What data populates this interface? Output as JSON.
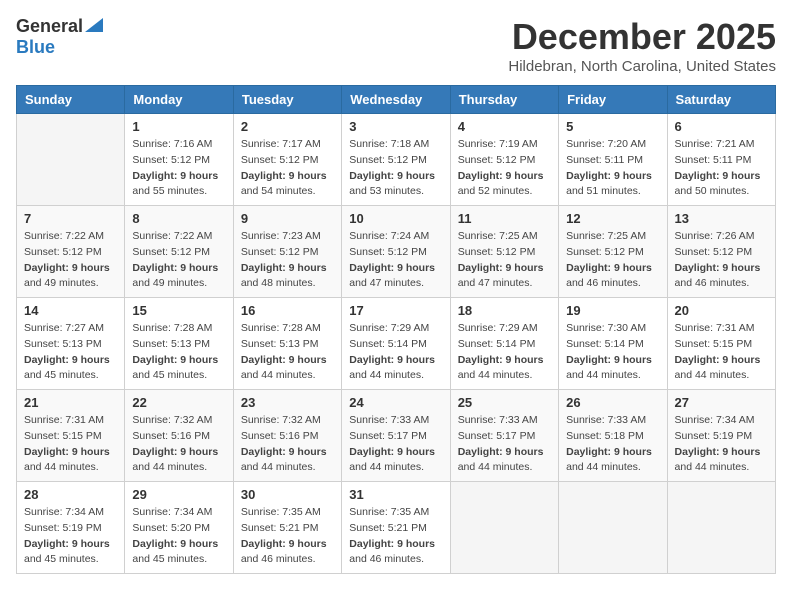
{
  "logo": {
    "general": "General",
    "blue": "Blue"
  },
  "title": "December 2025",
  "location": "Hildebran, North Carolina, United States",
  "days_of_week": [
    "Sunday",
    "Monday",
    "Tuesday",
    "Wednesday",
    "Thursday",
    "Friday",
    "Saturday"
  ],
  "weeks": [
    [
      {
        "day": "",
        "info": ""
      },
      {
        "day": "1",
        "info": "Sunrise: 7:16 AM\nSunset: 5:12 PM\nDaylight: 9 hours\nand 55 minutes."
      },
      {
        "day": "2",
        "info": "Sunrise: 7:17 AM\nSunset: 5:12 PM\nDaylight: 9 hours\nand 54 minutes."
      },
      {
        "day": "3",
        "info": "Sunrise: 7:18 AM\nSunset: 5:12 PM\nDaylight: 9 hours\nand 53 minutes."
      },
      {
        "day": "4",
        "info": "Sunrise: 7:19 AM\nSunset: 5:12 PM\nDaylight: 9 hours\nand 52 minutes."
      },
      {
        "day": "5",
        "info": "Sunrise: 7:20 AM\nSunset: 5:11 PM\nDaylight: 9 hours\nand 51 minutes."
      },
      {
        "day": "6",
        "info": "Sunrise: 7:21 AM\nSunset: 5:11 PM\nDaylight: 9 hours\nand 50 minutes."
      }
    ],
    [
      {
        "day": "7",
        "info": "Sunrise: 7:22 AM\nSunset: 5:12 PM\nDaylight: 9 hours\nand 49 minutes."
      },
      {
        "day": "8",
        "info": "Sunrise: 7:22 AM\nSunset: 5:12 PM\nDaylight: 9 hours\nand 49 minutes."
      },
      {
        "day": "9",
        "info": "Sunrise: 7:23 AM\nSunset: 5:12 PM\nDaylight: 9 hours\nand 48 minutes."
      },
      {
        "day": "10",
        "info": "Sunrise: 7:24 AM\nSunset: 5:12 PM\nDaylight: 9 hours\nand 47 minutes."
      },
      {
        "day": "11",
        "info": "Sunrise: 7:25 AM\nSunset: 5:12 PM\nDaylight: 9 hours\nand 47 minutes."
      },
      {
        "day": "12",
        "info": "Sunrise: 7:25 AM\nSunset: 5:12 PM\nDaylight: 9 hours\nand 46 minutes."
      },
      {
        "day": "13",
        "info": "Sunrise: 7:26 AM\nSunset: 5:12 PM\nDaylight: 9 hours\nand 46 minutes."
      }
    ],
    [
      {
        "day": "14",
        "info": "Sunrise: 7:27 AM\nSunset: 5:13 PM\nDaylight: 9 hours\nand 45 minutes."
      },
      {
        "day": "15",
        "info": "Sunrise: 7:28 AM\nSunset: 5:13 PM\nDaylight: 9 hours\nand 45 minutes."
      },
      {
        "day": "16",
        "info": "Sunrise: 7:28 AM\nSunset: 5:13 PM\nDaylight: 9 hours\nand 44 minutes."
      },
      {
        "day": "17",
        "info": "Sunrise: 7:29 AM\nSunset: 5:14 PM\nDaylight: 9 hours\nand 44 minutes."
      },
      {
        "day": "18",
        "info": "Sunrise: 7:29 AM\nSunset: 5:14 PM\nDaylight: 9 hours\nand 44 minutes."
      },
      {
        "day": "19",
        "info": "Sunrise: 7:30 AM\nSunset: 5:14 PM\nDaylight: 9 hours\nand 44 minutes."
      },
      {
        "day": "20",
        "info": "Sunrise: 7:31 AM\nSunset: 5:15 PM\nDaylight: 9 hours\nand 44 minutes."
      }
    ],
    [
      {
        "day": "21",
        "info": "Sunrise: 7:31 AM\nSunset: 5:15 PM\nDaylight: 9 hours\nand 44 minutes."
      },
      {
        "day": "22",
        "info": "Sunrise: 7:32 AM\nSunset: 5:16 PM\nDaylight: 9 hours\nand 44 minutes."
      },
      {
        "day": "23",
        "info": "Sunrise: 7:32 AM\nSunset: 5:16 PM\nDaylight: 9 hours\nand 44 minutes."
      },
      {
        "day": "24",
        "info": "Sunrise: 7:33 AM\nSunset: 5:17 PM\nDaylight: 9 hours\nand 44 minutes."
      },
      {
        "day": "25",
        "info": "Sunrise: 7:33 AM\nSunset: 5:17 PM\nDaylight: 9 hours\nand 44 minutes."
      },
      {
        "day": "26",
        "info": "Sunrise: 7:33 AM\nSunset: 5:18 PM\nDaylight: 9 hours\nand 44 minutes."
      },
      {
        "day": "27",
        "info": "Sunrise: 7:34 AM\nSunset: 5:19 PM\nDaylight: 9 hours\nand 44 minutes."
      }
    ],
    [
      {
        "day": "28",
        "info": "Sunrise: 7:34 AM\nSunset: 5:19 PM\nDaylight: 9 hours\nand 45 minutes."
      },
      {
        "day": "29",
        "info": "Sunrise: 7:34 AM\nSunset: 5:20 PM\nDaylight: 9 hours\nand 45 minutes."
      },
      {
        "day": "30",
        "info": "Sunrise: 7:35 AM\nSunset: 5:21 PM\nDaylight: 9 hours\nand 46 minutes."
      },
      {
        "day": "31",
        "info": "Sunrise: 7:35 AM\nSunset: 5:21 PM\nDaylight: 9 hours\nand 46 minutes."
      },
      {
        "day": "",
        "info": ""
      },
      {
        "day": "",
        "info": ""
      },
      {
        "day": "",
        "info": ""
      }
    ]
  ]
}
